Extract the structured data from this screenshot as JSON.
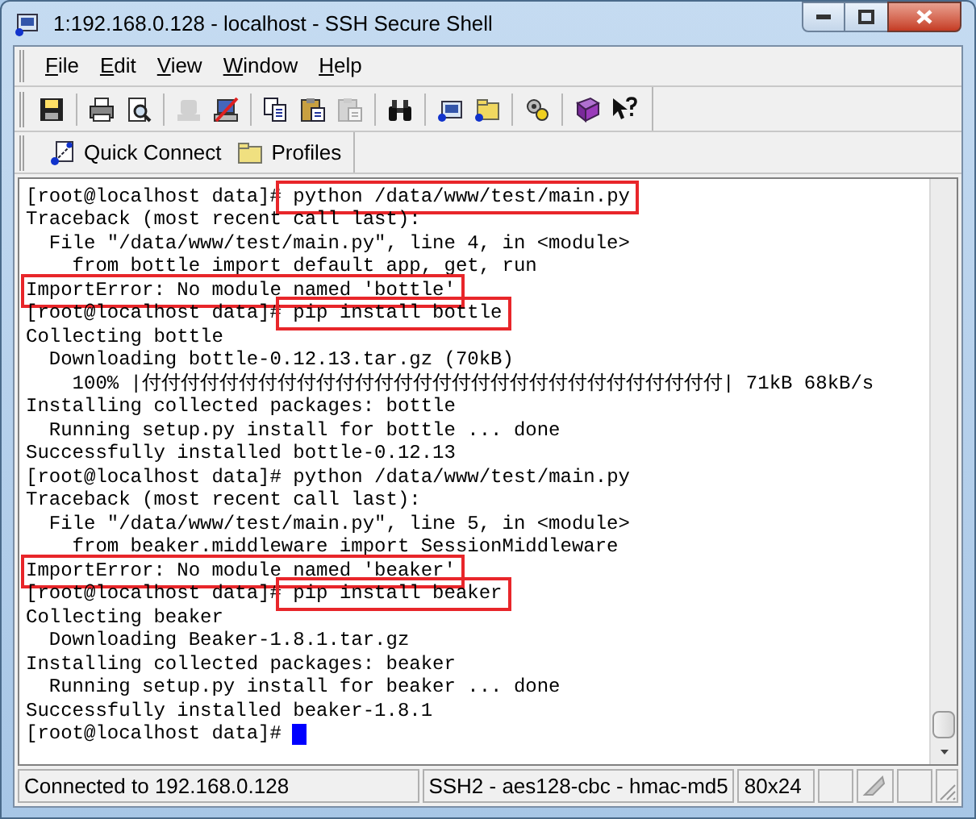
{
  "window": {
    "title": "1:192.168.0.128 - localhost - SSH Secure Shell"
  },
  "menu": [
    "File",
    "Edit",
    "View",
    "Window",
    "Help"
  ],
  "toolbar": [
    {
      "kind": "save",
      "disabled": false
    },
    {
      "kind": "sep"
    },
    {
      "kind": "print",
      "disabled": false
    },
    {
      "kind": "preview",
      "disabled": false
    },
    {
      "kind": "sep"
    },
    {
      "kind": "disconnect",
      "disabled": true
    },
    {
      "kind": "noconnect",
      "disabled": false
    },
    {
      "kind": "sep"
    },
    {
      "kind": "copy",
      "disabled": false
    },
    {
      "kind": "paste",
      "disabled": false
    },
    {
      "kind": "paste",
      "disabled": true
    },
    {
      "kind": "sep"
    },
    {
      "kind": "find",
      "disabled": false
    },
    {
      "kind": "sep"
    },
    {
      "kind": "terminal",
      "disabled": false
    },
    {
      "kind": "folder",
      "disabled": false
    },
    {
      "kind": "sep"
    },
    {
      "kind": "settings",
      "disabled": false
    },
    {
      "kind": "sep"
    },
    {
      "kind": "book",
      "disabled": false
    },
    {
      "kind": "whatsthis",
      "disabled": false
    }
  ],
  "quick_bar": [
    {
      "kind": "connect",
      "label": "Quick Connect"
    },
    {
      "kind": "profiles",
      "label": "Profiles"
    }
  ],
  "terminal": {
    "lines": [
      {
        "prompt": "[root@localhost data]#",
        "text": " python /data/www/test/main.py",
        "boxed": true
      },
      {
        "text": "Traceback (most recent call last):",
        "boxed": false
      },
      {
        "text": "  File \"/data/www/test/main.py\", line 4, in <module>",
        "boxed": false
      },
      {
        "text": "    from bottle import default app, get, run",
        "boxed": false
      },
      {
        "text": "ImportError: No module named 'bottle'",
        "boxed": true
      },
      {
        "prompt": "[root@localhost data]#",
        "text": " pip install bottle",
        "boxed": true
      },
      {
        "text": "Collecting bottle",
        "boxed": false
      },
      {
        "text": "  Downloading bottle-0.12.13.tar.gz (70kB)",
        "boxed": false
      },
      {
        "text": "    100% |付付付付付付付付付付付付付付付付付付付付付付付付付付付付付付| 71kB 68kB/s",
        "boxed": false
      },
      {
        "text": "Installing collected packages: bottle",
        "boxed": false
      },
      {
        "text": "  Running setup.py install for bottle ... done",
        "boxed": false
      },
      {
        "text": "Successfully installed bottle-0.12.13",
        "boxed": false
      },
      {
        "prompt": "[root@localhost data]#",
        "text": " python /data/www/test/main.py",
        "boxed": false
      },
      {
        "text": "Traceback (most recent call last):",
        "boxed": false
      },
      {
        "text": "  File \"/data/www/test/main.py\", line 5, in <module>",
        "boxed": false
      },
      {
        "text": "    from beaker.middleware import SessionMiddleware",
        "boxed": false
      },
      {
        "text": "ImportError: No module named 'beaker'",
        "boxed": true
      },
      {
        "prompt": "[root@localhost data]#",
        "text": " pip install beaker",
        "boxed": true
      },
      {
        "text": "Collecting beaker",
        "boxed": false
      },
      {
        "text": "  Downloading Beaker-1.8.1.tar.gz",
        "boxed": false
      },
      {
        "text": "Installing collected packages: beaker",
        "boxed": false
      },
      {
        "text": "  Running setup.py install for beaker ... done",
        "boxed": false
      },
      {
        "text": "Successfully installed beaker-1.8.1",
        "boxed": false
      },
      {
        "prompt": "[root@localhost data]#",
        "boxed": false
      }
    ],
    "cursor": true
  },
  "status_bar": {
    "connection": "Connected to 192.168.0.128",
    "cipher": "SSH2 - aes128-cbc - hmac-md5",
    "size": "80x24"
  }
}
